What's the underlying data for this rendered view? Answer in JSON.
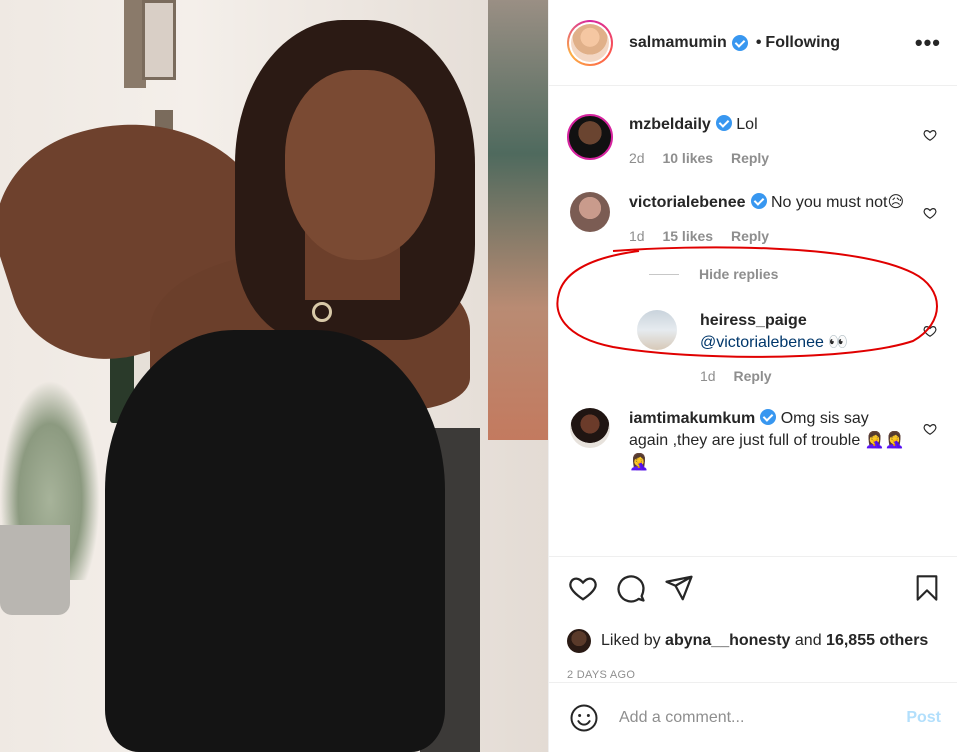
{
  "post": {
    "author": "salmamumin",
    "follow_status": "Following",
    "dot": "•",
    "more": "•••"
  },
  "comments": [
    {
      "user": "mzbeldaily",
      "text": "Lol",
      "age": "2d",
      "likes": "10 likes",
      "reply": "Reply",
      "verified": true
    },
    {
      "user": "victorialebenee",
      "text": "No you must not😥",
      "age": "1d",
      "likes": "15 likes",
      "reply": "Reply",
      "verified": true
    }
  ],
  "hide_replies": "Hide replies",
  "replies": [
    {
      "user": "heiress_paige",
      "text": "@victorialebenee 👀",
      "age": "1d",
      "reply": "Reply"
    }
  ],
  "comment3": {
    "user": "iamtimakumkum",
    "text": "Omg sis say again ,they are just full of trouble 🤦‍♀️🤦‍♀️🤦‍♀️",
    "verified": true
  },
  "likes_line": {
    "prefix": "Liked by",
    "user": "abyna__honesty",
    "mid": "and",
    "count": "16,855 others"
  },
  "date": "2 DAYS AGO",
  "add_comment": {
    "placeholder": "Add a comment...",
    "post_label": "Post"
  },
  "colors": {
    "verified": "#3897f0",
    "annotation": "#e00000",
    "post_disabled": "#b2dffc"
  }
}
